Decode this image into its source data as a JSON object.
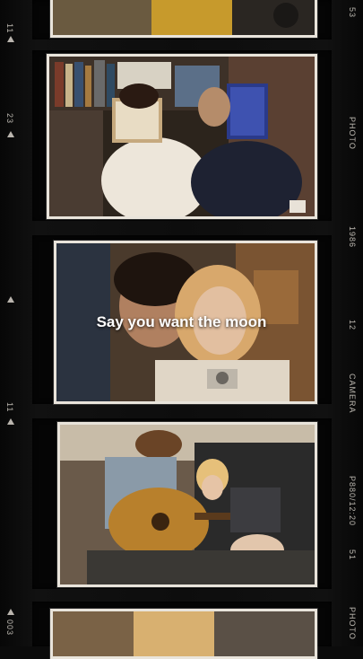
{
  "caption": "Say you want the moon",
  "film_strip": {
    "left_numbers": [
      "11",
      "23",
      "11",
      "003"
    ],
    "right_labels": [
      "53",
      "PHOTO",
      "1986",
      "12",
      "CAMERA",
      "P880/12:20",
      "51",
      "PHOTO"
    ]
  },
  "photos": [
    {
      "id": "top-partial",
      "description": "partial photo top"
    },
    {
      "id": "bookshelf-couple",
      "description": "couple reading books"
    },
    {
      "id": "couple-closeup",
      "description": "couple close-up"
    },
    {
      "id": "guitar-couple",
      "description": "guitar and girl"
    },
    {
      "id": "bottom-partial",
      "description": "partial photo bottom"
    }
  ],
  "colors": {
    "film_background": "#0b0b0b",
    "paper_edge": "#e9e4db",
    "caption_text": "#ffffff",
    "side_text": "#d9d4cb"
  }
}
